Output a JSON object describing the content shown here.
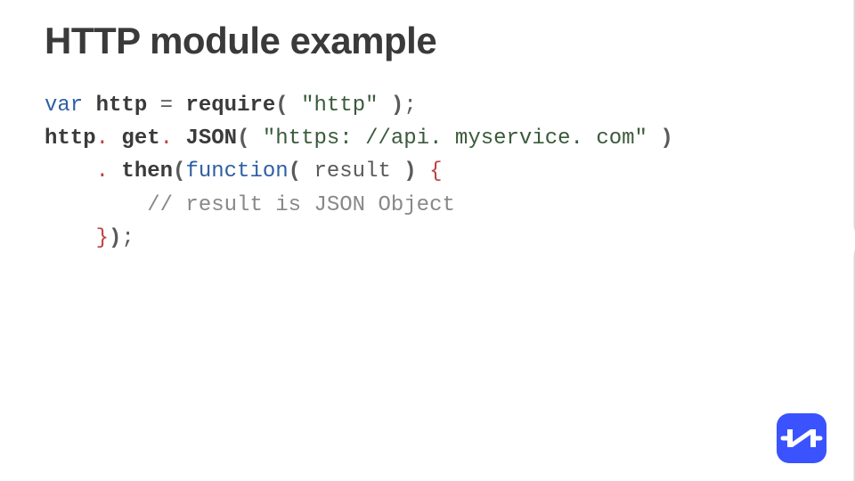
{
  "title": "HTTP module example",
  "code": {
    "l1": {
      "var": "var",
      "http": "http",
      "eq": "=",
      "require": "require",
      "lp": "(",
      "str": "\"http\"",
      "rp": ")",
      "semi": ";"
    },
    "l2": {
      "http": "http",
      "dot1": ". ",
      "get": "get",
      "dot2": ". ",
      "json": "JSON",
      "lp": "(",
      "str": "\"https: //api. myservice. com\"",
      "rp": ")"
    },
    "l3": {
      "dot": ". ",
      "then": "then",
      "lp": "(",
      "function": "function",
      "lp2": "(",
      "result": "result",
      "rp2": ")",
      "brace": "{"
    },
    "l4": {
      "comment": "// result is JSON Object"
    },
    "l5": {
      "brace": "}",
      "rp": ")",
      "semi": ";"
    }
  },
  "logo_letter": "N"
}
